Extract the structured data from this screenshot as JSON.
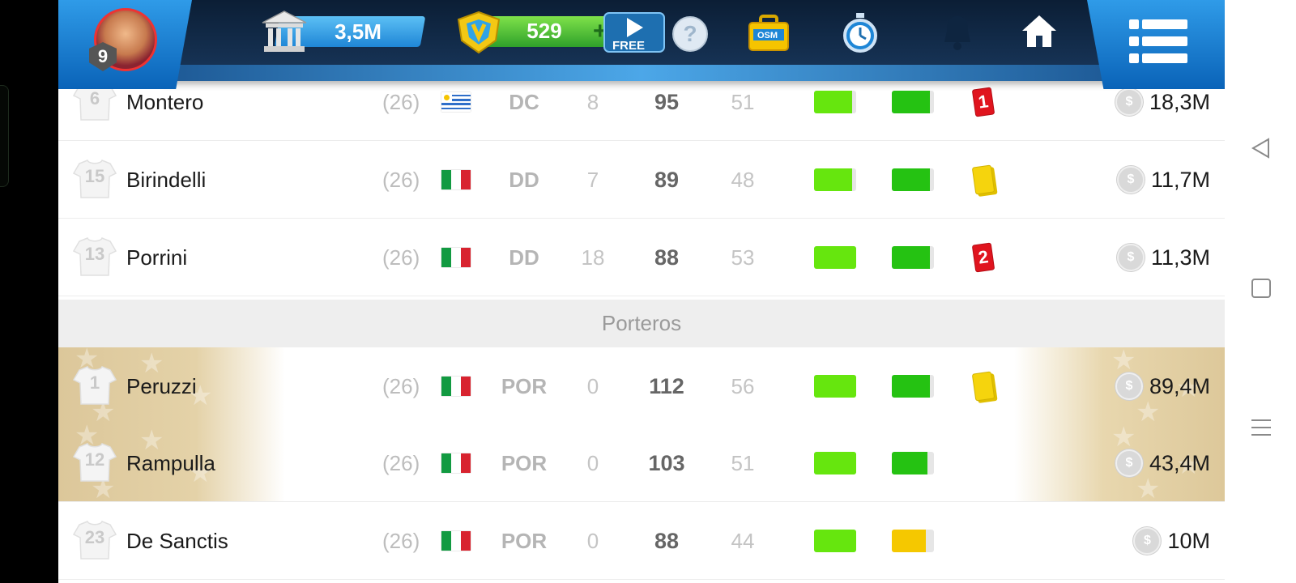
{
  "header": {
    "level": "9",
    "money": "3,5M",
    "coins": "529",
    "coins_plus": "+",
    "free_label": "FREE",
    "help_label": "?",
    "shop_label": "OSM"
  },
  "section_goalkeepers": "Porteros",
  "players_top": [
    {
      "shirt": "6",
      "name": "Montero",
      "age": "(26)",
      "flag": "uruguay",
      "pos": "DC",
      "n1": "8",
      "n2": "95",
      "n3": "51",
      "bar1": 0.9,
      "bar2": 0.9,
      "bar2_color": "#25c212",
      "card": "red",
      "card_text": "1",
      "value": "18,3M"
    },
    {
      "shirt": "15",
      "name": "Birindelli",
      "age": "(26)",
      "flag": "italy",
      "pos": "DD",
      "n1": "7",
      "n2": "89",
      "n3": "48",
      "bar1": 0.9,
      "bar2": 0.9,
      "bar2_color": "#25c212",
      "card": "yellow",
      "card_text": "",
      "value": "11,7M"
    },
    {
      "shirt": "13",
      "name": "Porrini",
      "age": "(26)",
      "flag": "italy",
      "pos": "DD",
      "n1": "18",
      "n2": "88",
      "n3": "53",
      "bar1": 1.0,
      "bar2": 0.9,
      "bar2_color": "#25c212",
      "card": "red",
      "card_text": "2",
      "value": "11,3M"
    }
  ],
  "players_gk": [
    {
      "shirt": "1",
      "name": "Peruzzi",
      "age": "(26)",
      "flag": "italy",
      "pos": "POR",
      "n1": "0",
      "n2": "112",
      "n3": "56",
      "bar1": 1.0,
      "bar2": 0.9,
      "bar2_color": "#25c212",
      "card": "yellow",
      "card_text": "",
      "value": "89,4M",
      "gold": true
    },
    {
      "shirt": "12",
      "name": "Rampulla",
      "age": "(26)",
      "flag": "italy",
      "pos": "POR",
      "n1": "0",
      "n2": "103",
      "n3": "51",
      "bar1": 1.0,
      "bar2": 0.85,
      "bar2_color": "#25c212",
      "card": "",
      "card_text": "",
      "value": "43,4M",
      "gold": true
    },
    {
      "shirt": "23",
      "name": "De Sanctis",
      "age": "(26)",
      "flag": "italy",
      "pos": "POR",
      "n1": "0",
      "n2": "88",
      "n3": "44",
      "bar1": 1.0,
      "bar2": 0.8,
      "bar2_color": "#f5c800",
      "card": "",
      "card_text": "",
      "value": "10M",
      "gold": false
    }
  ],
  "colors": {
    "bar1": "#66e60e",
    "gold": "#ddc89a",
    "topbar": "#0b1e35",
    "accent_blue": "#1e86d6"
  }
}
